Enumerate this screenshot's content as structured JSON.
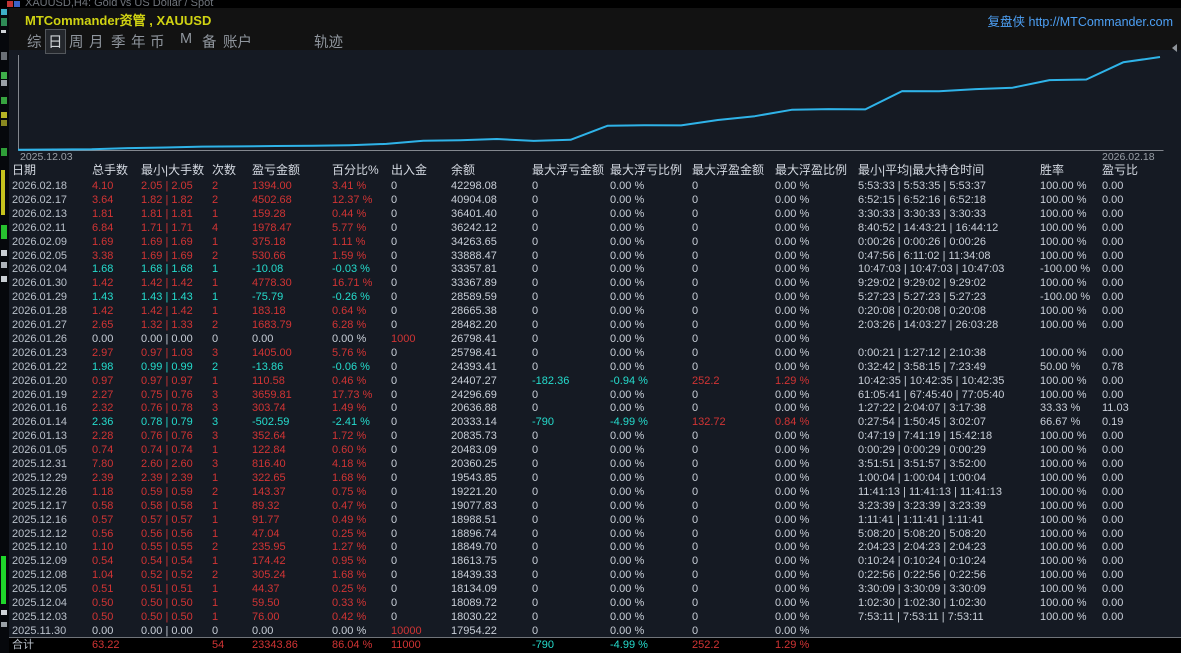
{
  "window": {
    "mt4_title": "XAUUSD,H4: Gold vs US Dollar / Spot"
  },
  "header": {
    "title": "MTCommander资管 , XAUUSD",
    "brand": "复盘侠 http://MTCommander.com"
  },
  "menu": {
    "items": [
      {
        "label": "综",
        "active": false
      },
      {
        "label": "日",
        "active": true
      },
      {
        "label": "周",
        "active": false
      },
      {
        "label": "月",
        "active": false
      },
      {
        "label": "季",
        "active": false
      },
      {
        "label": "年",
        "active": false
      },
      {
        "label": "币",
        "active": false
      },
      {
        "label": "M",
        "active": false
      },
      {
        "label": "备",
        "active": false
      },
      {
        "label": "账户",
        "active": false
      },
      {
        "label": "轨迹",
        "active": false
      }
    ]
  },
  "chart_data": {
    "type": "line",
    "title": "",
    "xlabel": "",
    "ylabel": "",
    "x_start_label": "2025.12.03",
    "x_end_label": "2026.02.18",
    "ylim": [
      17954.22,
      42298.08
    ],
    "grid": false,
    "legend": "none",
    "line_color": "#2fb3e8",
    "series": [
      {
        "name": "balance",
        "x": [
          "2025.12.03",
          "2025.12.04",
          "2025.12.05",
          "2025.12.08",
          "2025.12.09",
          "2025.12.10",
          "2025.12.12",
          "2025.12.16",
          "2025.12.17",
          "2025.12.26",
          "2025.12.29",
          "2025.12.31",
          "2026.01.05",
          "2026.01.13",
          "2026.01.14",
          "2026.01.16",
          "2026.01.19",
          "2026.01.20",
          "2026.01.22",
          "2026.01.23",
          "2026.01.26",
          "2026.01.27",
          "2026.01.28",
          "2026.01.29",
          "2026.01.30",
          "2026.02.04",
          "2026.02.05",
          "2026.02.09",
          "2026.02.11",
          "2026.02.13",
          "2026.02.17",
          "2026.02.18"
        ],
        "values": [
          18030.22,
          18089.72,
          18134.09,
          18439.33,
          18613.75,
          18849.7,
          18896.74,
          18988.51,
          19077.83,
          19221.2,
          19543.85,
          20360.25,
          20483.09,
          20835.73,
          20333.14,
          20636.88,
          24296.69,
          24407.27,
          24393.41,
          25798.41,
          26798.41,
          28482.2,
          28665.38,
          28589.59,
          33367.89,
          33357.81,
          33888.47,
          34263.65,
          36242.12,
          36401.4,
          40904.08,
          42298.08
        ]
      }
    ]
  },
  "table": {
    "columns": [
      "日期",
      "总手数",
      "最小|大手数",
      "次数",
      "盈亏金额",
      "百分比%",
      "出入金",
      "余额",
      "最大浮亏金额",
      "最大浮亏比例",
      "最大浮盈金额",
      "最大浮盈比例",
      "最小|平均|最大持仓时间",
      "胜率",
      "盈亏比"
    ],
    "rows": [
      {
        "tone": "p",
        "cells": [
          "2026.02.18",
          "4.10",
          "2.05 | 2.05",
          "2",
          "1394.00",
          "3.41 %",
          "0",
          "42298.08",
          "0",
          "0.00 %",
          "0",
          "0.00 %",
          "5:53:33 | 5:53:35 | 5:53:37",
          "100.00 %",
          "0.00"
        ]
      },
      {
        "tone": "p",
        "cells": [
          "2026.02.17",
          "3.64",
          "1.82 | 1.82",
          "2",
          "4502.68",
          "12.37 %",
          "0",
          "40904.08",
          "0",
          "0.00 %",
          "0",
          "0.00 %",
          "6:52:15 | 6:52:16 | 6:52:18",
          "100.00 %",
          "0.00"
        ]
      },
      {
        "tone": "p",
        "cells": [
          "2026.02.13",
          "1.81",
          "1.81 | 1.81",
          "1",
          "159.28",
          "0.44 %",
          "0",
          "36401.40",
          "0",
          "0.00 %",
          "0",
          "0.00 %",
          "3:30:33 | 3:30:33 | 3:30:33",
          "100.00 %",
          "0.00"
        ]
      },
      {
        "tone": "p",
        "cells": [
          "2026.02.11",
          "6.84",
          "1.71 | 1.71",
          "4",
          "1978.47",
          "5.77 %",
          "0",
          "36242.12",
          "0",
          "0.00 %",
          "0",
          "0.00 %",
          "8:40:52 | 14:43:21 | 16:44:12",
          "100.00 %",
          "0.00"
        ]
      },
      {
        "tone": "p",
        "cells": [
          "2026.02.09",
          "1.69",
          "1.69 | 1.69",
          "1",
          "375.18",
          "1.11 %",
          "0",
          "34263.65",
          "0",
          "0.00 %",
          "0",
          "0.00 %",
          "0:00:26 | 0:00:26 | 0:00:26",
          "100.00 %",
          "0.00"
        ]
      },
      {
        "tone": "p",
        "cells": [
          "2026.02.05",
          "3.38",
          "1.69 | 1.69",
          "2",
          "530.66",
          "1.59 %",
          "0",
          "33888.47",
          "0",
          "0.00 %",
          "0",
          "0.00 %",
          "0:47:56 | 6:11:02 | 11:34:08",
          "100.00 %",
          "0.00"
        ]
      },
      {
        "tone": "n",
        "cells": [
          "2026.02.04",
          "1.68",
          "1.68 | 1.68",
          "1",
          "-10.08",
          "-0.03 %",
          "0",
          "33357.81",
          "0",
          "0.00 %",
          "0",
          "0.00 %",
          "10:47:03 | 10:47:03 | 10:47:03",
          "-100.00 %",
          "0.00"
        ]
      },
      {
        "tone": "p",
        "cells": [
          "2026.01.30",
          "1.42",
          "1.42 | 1.42",
          "1",
          "4778.30",
          "16.71 %",
          "0",
          "33367.89",
          "0",
          "0.00 %",
          "0",
          "0.00 %",
          "9:29:02 | 9:29:02 | 9:29:02",
          "100.00 %",
          "0.00"
        ]
      },
      {
        "tone": "n",
        "cells": [
          "2026.01.29",
          "1.43",
          "1.43 | 1.43",
          "1",
          "-75.79",
          "-0.26 %",
          "0",
          "28589.59",
          "0",
          "0.00 %",
          "0",
          "0.00 %",
          "5:27:23 | 5:27:23 | 5:27:23",
          "-100.00 %",
          "0.00"
        ]
      },
      {
        "tone": "p",
        "cells": [
          "2026.01.28",
          "1.42",
          "1.42 | 1.42",
          "1",
          "183.18",
          "0.64 %",
          "0",
          "28665.38",
          "0",
          "0.00 %",
          "0",
          "0.00 %",
          "0:20:08 | 0:20:08 | 0:20:08",
          "100.00 %",
          "0.00"
        ]
      },
      {
        "tone": "p",
        "cells": [
          "2026.01.27",
          "2.65",
          "1.32 | 1.33",
          "2",
          "1683.79",
          "6.28 %",
          "0",
          "28482.20",
          "0",
          "0.00 %",
          "0",
          "0.00 %",
          "2:03:26 | 14:03:27 | 26:03:28",
          "100.00 %",
          "0.00"
        ]
      },
      {
        "tone": "z",
        "cells": [
          "2026.01.26",
          "0.00",
          "0.00 | 0.00",
          "0",
          "0.00",
          "0.00 %",
          "1000",
          "26798.41",
          "0",
          "0.00 %",
          "0",
          "0.00 %",
          "",
          "",
          ""
        ]
      },
      {
        "tone": "p",
        "cells": [
          "2026.01.23",
          "2.97",
          "0.97 | 1.03",
          "3",
          "1405.00",
          "5.76 %",
          "0",
          "25798.41",
          "0",
          "0.00 %",
          "0",
          "0.00 %",
          "0:00:21 | 1:27:12 | 2:10:38",
          "100.00 %",
          "0.00"
        ]
      },
      {
        "tone": "n",
        "cells": [
          "2026.01.22",
          "1.98",
          "0.99 | 0.99",
          "2",
          "-13.86",
          "-0.06 %",
          "0",
          "24393.41",
          "0",
          "0.00 %",
          "0",
          "0.00 %",
          "0:32:42 | 3:58:15 | 7:23:49",
          "50.00 %",
          "0.78"
        ]
      },
      {
        "tone": "p",
        "cells": [
          "2026.01.20",
          "0.97",
          "0.97 | 0.97",
          "1",
          "110.58",
          "0.46 %",
          "0",
          "24407.27",
          "-182.36",
          "-0.94 %",
          "252.2",
          "1.29 %",
          "10:42:35 | 10:42:35 | 10:42:35",
          "100.00 %",
          "0.00"
        ]
      },
      {
        "tone": "p",
        "cells": [
          "2026.01.19",
          "2.27",
          "0.75 | 0.76",
          "3",
          "3659.81",
          "17.73 %",
          "0",
          "24296.69",
          "0",
          "0.00 %",
          "0",
          "0.00 %",
          "61:05:41 | 67:45:40 | 77:05:40",
          "100.00 %",
          "0.00"
        ]
      },
      {
        "tone": "p",
        "cells": [
          "2026.01.16",
          "2.32",
          "0.76 | 0.78",
          "3",
          "303.74",
          "1.49 %",
          "0",
          "20636.88",
          "0",
          "0.00 %",
          "0",
          "0.00 %",
          "1:27:22 | 2:04:07 | 3:17:38",
          "33.33 %",
          "11.03"
        ]
      },
      {
        "tone": "n",
        "cells": [
          "2026.01.14",
          "2.36",
          "0.78 | 0.79",
          "3",
          "-502.59",
          "-2.41 %",
          "0",
          "20333.14",
          "-790",
          "-4.99 %",
          "132.72",
          "0.84 %",
          "0:27:54 | 1:50:45 | 3:02:07",
          "66.67 %",
          "0.19"
        ]
      },
      {
        "tone": "p",
        "cells": [
          "2026.01.13",
          "2.28",
          "0.76 | 0.76",
          "3",
          "352.64",
          "1.72 %",
          "0",
          "20835.73",
          "0",
          "0.00 %",
          "0",
          "0.00 %",
          "0:47:19 | 7:41:19 | 15:42:18",
          "100.00 %",
          "0.00"
        ]
      },
      {
        "tone": "p",
        "cells": [
          "2026.01.05",
          "0.74",
          "0.74 | 0.74",
          "1",
          "122.84",
          "0.60 %",
          "0",
          "20483.09",
          "0",
          "0.00 %",
          "0",
          "0.00 %",
          "0:00:29 | 0:00:29 | 0:00:29",
          "100.00 %",
          "0.00"
        ]
      },
      {
        "tone": "p",
        "cells": [
          "2025.12.31",
          "7.80",
          "2.60 | 2.60",
          "3",
          "816.40",
          "4.18 %",
          "0",
          "20360.25",
          "0",
          "0.00 %",
          "0",
          "0.00 %",
          "3:51:51 | 3:51:57 | 3:52:00",
          "100.00 %",
          "0.00"
        ]
      },
      {
        "tone": "p",
        "cells": [
          "2025.12.29",
          "2.39",
          "2.39 | 2.39",
          "1",
          "322.65",
          "1.68 %",
          "0",
          "19543.85",
          "0",
          "0.00 %",
          "0",
          "0.00 %",
          "1:00:04 | 1:00:04 | 1:00:04",
          "100.00 %",
          "0.00"
        ]
      },
      {
        "tone": "p",
        "cells": [
          "2025.12.26",
          "1.18",
          "0.59 | 0.59",
          "2",
          "143.37",
          "0.75 %",
          "0",
          "19221.20",
          "0",
          "0.00 %",
          "0",
          "0.00 %",
          "11:41:13 | 11:41:13 | 11:41:13",
          "100.00 %",
          "0.00"
        ]
      },
      {
        "tone": "p",
        "cells": [
          "2025.12.17",
          "0.58",
          "0.58 | 0.58",
          "1",
          "89.32",
          "0.47 %",
          "0",
          "19077.83",
          "0",
          "0.00 %",
          "0",
          "0.00 %",
          "3:23:39 | 3:23:39 | 3:23:39",
          "100.00 %",
          "0.00"
        ]
      },
      {
        "tone": "p",
        "cells": [
          "2025.12.16",
          "0.57",
          "0.57 | 0.57",
          "1",
          "91.77",
          "0.49 %",
          "0",
          "18988.51",
          "0",
          "0.00 %",
          "0",
          "0.00 %",
          "1:11:41 | 1:11:41 | 1:11:41",
          "100.00 %",
          "0.00"
        ]
      },
      {
        "tone": "p",
        "cells": [
          "2025.12.12",
          "0.56",
          "0.56 | 0.56",
          "1",
          "47.04",
          "0.25 %",
          "0",
          "18896.74",
          "0",
          "0.00 %",
          "0",
          "0.00 %",
          "5:08:20 | 5:08:20 | 5:08:20",
          "100.00 %",
          "0.00"
        ]
      },
      {
        "tone": "p",
        "cells": [
          "2025.12.10",
          "1.10",
          "0.55 | 0.55",
          "2",
          "235.95",
          "1.27 %",
          "0",
          "18849.70",
          "0",
          "0.00 %",
          "0",
          "0.00 %",
          "2:04:23 | 2:04:23 | 2:04:23",
          "100.00 %",
          "0.00"
        ]
      },
      {
        "tone": "p",
        "cells": [
          "2025.12.09",
          "0.54",
          "0.54 | 0.54",
          "1",
          "174.42",
          "0.95 %",
          "0",
          "18613.75",
          "0",
          "0.00 %",
          "0",
          "0.00 %",
          "0:10:24 | 0:10:24 | 0:10:24",
          "100.00 %",
          "0.00"
        ]
      },
      {
        "tone": "p",
        "cells": [
          "2025.12.08",
          "1.04",
          "0.52 | 0.52",
          "2",
          "305.24",
          "1.68 %",
          "0",
          "18439.33",
          "0",
          "0.00 %",
          "0",
          "0.00 %",
          "0:22:56 | 0:22:56 | 0:22:56",
          "100.00 %",
          "0.00"
        ]
      },
      {
        "tone": "p",
        "cells": [
          "2025.12.05",
          "0.51",
          "0.51 | 0.51",
          "1",
          "44.37",
          "0.25 %",
          "0",
          "18134.09",
          "0",
          "0.00 %",
          "0",
          "0.00 %",
          "3:30:09 | 3:30:09 | 3:30:09",
          "100.00 %",
          "0.00"
        ]
      },
      {
        "tone": "p",
        "cells": [
          "2025.12.04",
          "0.50",
          "0.50 | 0.50",
          "1",
          "59.50",
          "0.33 %",
          "0",
          "18089.72",
          "0",
          "0.00 %",
          "0",
          "0.00 %",
          "1:02:30 | 1:02:30 | 1:02:30",
          "100.00 %",
          "0.00"
        ]
      },
      {
        "tone": "p",
        "cells": [
          "2025.12.03",
          "0.50",
          "0.50 | 0.50",
          "1",
          "76.00",
          "0.42 %",
          "0",
          "18030.22",
          "0",
          "0.00 %",
          "0",
          "0.00 %",
          "7:53:11 | 7:53:11 | 7:53:11",
          "100.00 %",
          "0.00"
        ]
      },
      {
        "tone": "z",
        "cells": [
          "2025.11.30",
          "0.00",
          "0.00 | 0.00",
          "0",
          "0.00",
          "0.00 %",
          "10000",
          "17954.22",
          "0",
          "0.00 %",
          "0",
          "0.00 %",
          "",
          "",
          ""
        ]
      }
    ],
    "total": {
      "tone": "p",
      "cells": [
        "合计",
        "63.22",
        "",
        "54",
        "23343.86",
        "86.04 %",
        "11000",
        "",
        "-790",
        "-4.99 %",
        "252.2",
        "1.29 %",
        "",
        "",
        ""
      ]
    }
  }
}
